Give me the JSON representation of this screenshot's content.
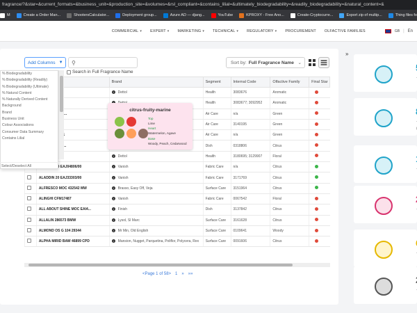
{
  "browser": {
    "url": "fragrance/?&star=&current_formats=&business_unit=&production_site=&volumes=&rsl_compliant=&contains_lilial=&ultimately_biodegradability=&readily_biodegradability=&natural_content=&",
    "bookmarks": [
      {
        "label": "M",
        "color": "#ffffff"
      },
      {
        "label": "Create a Order Man...",
        "color": "#2d8cf0"
      },
      {
        "label": "ShootersCalculator...",
        "color": "#6b6b6b"
      },
      {
        "label": "Deployment group...",
        "color": "#1f6feb"
      },
      {
        "label": "Azure AD — djang...",
        "color": "#0078d4"
      },
      {
        "label": "YouTube",
        "color": "#ff0000"
      },
      {
        "label": "KPROXY - Free Ano...",
        "color": "#e2711d"
      },
      {
        "label": "Create-Cryptocurre...",
        "color": "#ffffff"
      },
      {
        "label": "Export zip of multip...",
        "color": "#42a5f5"
      },
      {
        "label": "Thing files for Pro",
        "color": "#1e88e5"
      }
    ]
  },
  "nav": {
    "items": [
      "COMMERCIAL",
      "EXPERT",
      "MARKETING",
      "TECHNICAL",
      "REGULATORY",
      "PROCUREMENT",
      "OLFACTIVE FAMILIES"
    ],
    "lang": "GB",
    "lang_sep": "|",
    "lang_text": "En"
  },
  "toolbar": {
    "add_columns": "Add Columns",
    "search_placeholder": "",
    "search_full_label": "Search in Full Fragrance Name",
    "sort_label": "Sort by:",
    "sort_value": "Full Fragrance Name"
  },
  "dropdown": {
    "items": [
      "% Biodegradability",
      "% Biodegradability (Readily)",
      "% Biodegradability (Ultimate)",
      "% Natural Content",
      "% Naturally Derived Content",
      "Background",
      "Brand",
      "Business Unit",
      "Colour Associations",
      "Consumer Data Summary",
      "Contains Lilial"
    ],
    "footer": "Select/Deselect All"
  },
  "table": {
    "headers": [
      "",
      "Name",
      "Brand",
      "Segment",
      "Internal Code",
      "Olfactive Family",
      "Final Star"
    ],
    "rows": [
      {
        "name": "...021 D",
        "brand": "Dettol",
        "segment": "Health",
        "code": "3083676",
        "family": "Aromatic",
        "status": "x"
      },
      {
        "name": "...021 DB",
        "brand": "Dettol",
        "segment": "Health",
        "code": "3083677; 3092952",
        "family": "Aromatic",
        "status": "x"
      },
      {
        "name": "...S MOC T1203...",
        "brand": "",
        "segment": "Air Care",
        "code": "n/a",
        "family": "Green",
        "status": "x"
      },
      {
        "name": "...US T11030...",
        "brand": "",
        "segment": "Air Care",
        "code": "3140195",
        "family": "Green",
        "status": "x"
      },
      {
        "name": "...PZ T12044661",
        "brand": "",
        "segment": "Air Care",
        "code": "n/a",
        "family": "Green",
        "status": "x"
      },
      {
        "name": "... VERDE LF C...",
        "brand": "Sole",
        "segment": "Dish",
        "code": "0318806",
        "family": "Citrus",
        "status": "x"
      },
      {
        "name": "...S G 119 19...",
        "brand": "Dettol",
        "segment": "Health",
        "code": "3180695; 3129907",
        "family": "Floral",
        "status": "x"
      },
      {
        "name": "ALADDIN 19 EAJ04806/00",
        "brand": "Vanish",
        "segment": "Fabric Care",
        "code": "n/a",
        "family": "Citrus",
        "status": "ok"
      },
      {
        "name": "ALADDIN 20 EAJ33303/00",
        "brand": "Vanish",
        "segment": "Fabric Care",
        "code": "3171769",
        "family": "Citrus",
        "status": "ok"
      },
      {
        "name": "ALFRESCO MOC 432542 MW",
        "brand": "Brasso, Easy Off, Veja",
        "segment": "Surface Care",
        "code": "3151964",
        "family": "Citrus",
        "status": "ok"
      },
      {
        "name": "ALINGHI CFM17487",
        "brand": "Vanish",
        "segment": "Fabric Care",
        "code": "0067542",
        "family": "Floral",
        "status": "x"
      },
      {
        "name": "ALL ABOUT SHINE MOC EAI4...",
        "brand": "Finish",
        "segment": "Dish",
        "code": "3137842",
        "family": "Citrus",
        "status": "x"
      },
      {
        "name": "ALLALIN 286573 BMW",
        "brand": "Lysol, Sl Marc",
        "segment": "Surface Care",
        "code": "3161628",
        "family": "Citrus",
        "status": "x"
      },
      {
        "name": "ALMOND OS G 104 29344",
        "brand": "Mr Min, Old English",
        "segment": "Surface Care",
        "code": "0109641",
        "family": "Woody",
        "status": "x"
      },
      {
        "name": "ALPHA MIRID BAW 46899 CPD",
        "brand": "Mansion, Nugget, Parquetina, Poliflor, Polycera, Rex",
        "segment": "Surface Care",
        "code": "0091606",
        "family": "Citrus",
        "status": "x"
      }
    ]
  },
  "pager": {
    "text": "<Page 1 of 58>",
    "page": "1",
    "next": "»",
    "last": "»»"
  },
  "popup": {
    "title": "citrus-fruity-marine",
    "top_label": "Top",
    "top_value": "Lime",
    "heart_label": "Heart",
    "heart_value": "Watermelon, Agave",
    "base_label": "Base",
    "base_value": "Woody, Peach, Cedarwood"
  },
  "side": {
    "toggle": "»",
    "cards": [
      {
        "num": "5",
        "cap": "To",
        "color": "#1fa3c9",
        "bg": "#d7f1f7"
      },
      {
        "num": "8",
        "cap": "To",
        "color": "#1fa3c9",
        "bg": "#d7f1f7",
        "cap2": "(H"
      },
      {
        "num": "1",
        "cap": "To",
        "color": "#1fa3c9",
        "bg": "#d7f1f7"
      },
      {
        "num": "2",
        "cap": "To",
        "color": "#d8336e",
        "bg": "#fbe1ea"
      },
      {
        "num": "6",
        "cap": "To",
        "color": "#e6b800",
        "bg": "#fff5cc"
      },
      {
        "num": "2",
        "cap": "To",
        "color": "#555555",
        "bg": "#dddddd"
      }
    ]
  }
}
